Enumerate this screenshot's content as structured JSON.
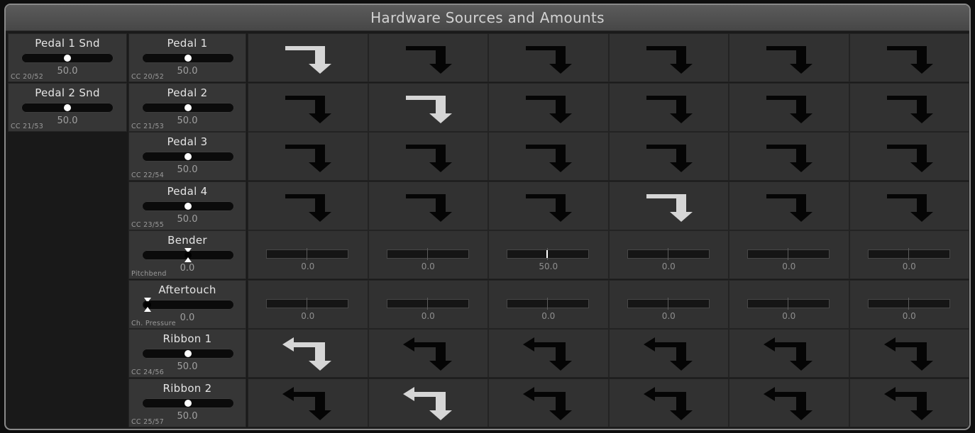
{
  "panel": {
    "title": "Hardware Sources and Amounts"
  },
  "send_sources": [
    {
      "name": "Pedal 1 Snd",
      "value": "50.0",
      "cc": "CC 20/52",
      "level": 0.5
    },
    {
      "name": "Pedal 2 Snd",
      "value": "50.0",
      "cc": "CC 21/53",
      "level": 0.5
    }
  ],
  "sources": [
    {
      "name": "Pedal 1",
      "value": "50.0",
      "cc": "CC 20/52",
      "kind": "pedal",
      "level": 0.5
    },
    {
      "name": "Pedal 2",
      "value": "50.0",
      "cc": "CC 21/53",
      "kind": "pedal",
      "level": 0.5
    },
    {
      "name": "Pedal 3",
      "value": "50.0",
      "cc": "CC 22/54",
      "kind": "pedal",
      "level": 0.5
    },
    {
      "name": "Pedal 4",
      "value": "50.0",
      "cc": "CC 23/55",
      "kind": "pedal",
      "level": 0.5
    },
    {
      "name": "Bender",
      "value": "0.0",
      "cc": "Pitchbend",
      "kind": "bender",
      "level": 0.5
    },
    {
      "name": "Aftertouch",
      "value": "0.0",
      "cc": "Ch. Pressure",
      "kind": "aftertouch",
      "level": 0.0
    },
    {
      "name": "Ribbon 1",
      "value": "50.0",
      "cc": "CC 24/56",
      "kind": "ribbon",
      "level": 0.5
    },
    {
      "name": "Ribbon 2",
      "value": "50.0",
      "cc": "CC 25/57",
      "kind": "ribbon",
      "level": 0.5
    }
  ],
  "matrix": [
    {
      "type": "arrow",
      "shape": "return",
      "active_index": 0
    },
    {
      "type": "arrow",
      "shape": "return",
      "active_index": 1
    },
    {
      "type": "arrow",
      "shape": "return",
      "active_index": -1
    },
    {
      "type": "arrow",
      "shape": "return",
      "active_index": 3
    },
    {
      "type": "amount",
      "values": [
        "0.0",
        "0.0",
        "50.0",
        "0.0",
        "0.0",
        "0.0"
      ],
      "fill": [
        0,
        0,
        0.5,
        0,
        0,
        0
      ]
    },
    {
      "type": "amount",
      "values": [
        "0.0",
        "0.0",
        "0.0",
        "0.0",
        "0.0",
        "0.0"
      ],
      "fill": [
        0,
        0,
        0,
        0,
        0,
        0
      ]
    },
    {
      "type": "arrow",
      "shape": "non-return",
      "active_index": 0
    },
    {
      "type": "arrow",
      "shape": "non-return",
      "active_index": 1
    }
  ],
  "colors": {
    "arrow_active": "#d6d6d6",
    "arrow_inactive": "#050505",
    "knob": "#ffffff",
    "amount_fill": "#9c9c9c"
  },
  "icons": {
    "return": "return-arrow-icon",
    "non_return": "non-return-arrow-icon",
    "bipolar_knob": "bipolar-knob-icon"
  }
}
